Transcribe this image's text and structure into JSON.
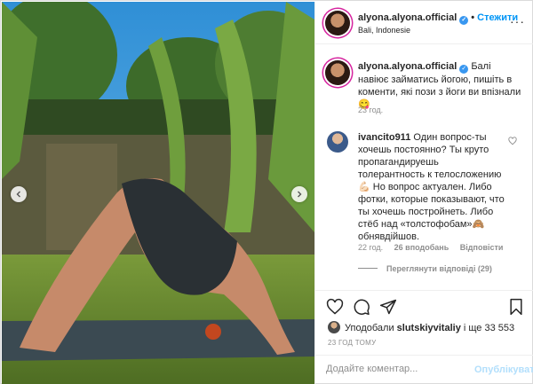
{
  "post": {
    "username": "alyona.alyona.official",
    "follow_label": "Стежити",
    "location": "Bali, Indonesie",
    "caption": {
      "username": "alyona.alyona.official",
      "text": "Балі навіює займатись йогою, пишіть в коменти, які пози з йоги ви впізнали😋",
      "time": "23 год."
    },
    "comments": [
      {
        "username": "ivancito911",
        "text": "Один вопрос-ты хочешь постоянно? Ты круто пропагандируешь толерантность к телосложению 💪🏻 Но вопрос актуален. Либо фотки, которые показывают, что ты хочешь постройнеть. Либо стёб над «толстофобам»🙈 обнявдійшов.",
        "time": "22 год.",
        "likes": "26 вподобань",
        "reply_label": "Відповісти",
        "view_replies": "Переглянути відповіді (29)"
      }
    ],
    "likes_text_prefix": "Уподобали ",
    "likes_user": "slutskiyvitaliy",
    "likes_text_suffix": " і ще 33 553",
    "date": "23 ГОД ТОМУ",
    "add_comment_placeholder": "Додайте коментар...",
    "publish_label": "Опублікувати"
  },
  "icons": {
    "verified": "verified-badge-icon",
    "more": "more-options-icon",
    "like": "heart-icon",
    "comment": "comment-icon",
    "share": "send-icon",
    "save": "bookmark-icon",
    "prev": "chevron-left-icon",
    "next": "chevron-right-icon"
  },
  "colors": {
    "accent": "#0095f6",
    "muted": "#8e8e8e",
    "border": "#efefef"
  }
}
